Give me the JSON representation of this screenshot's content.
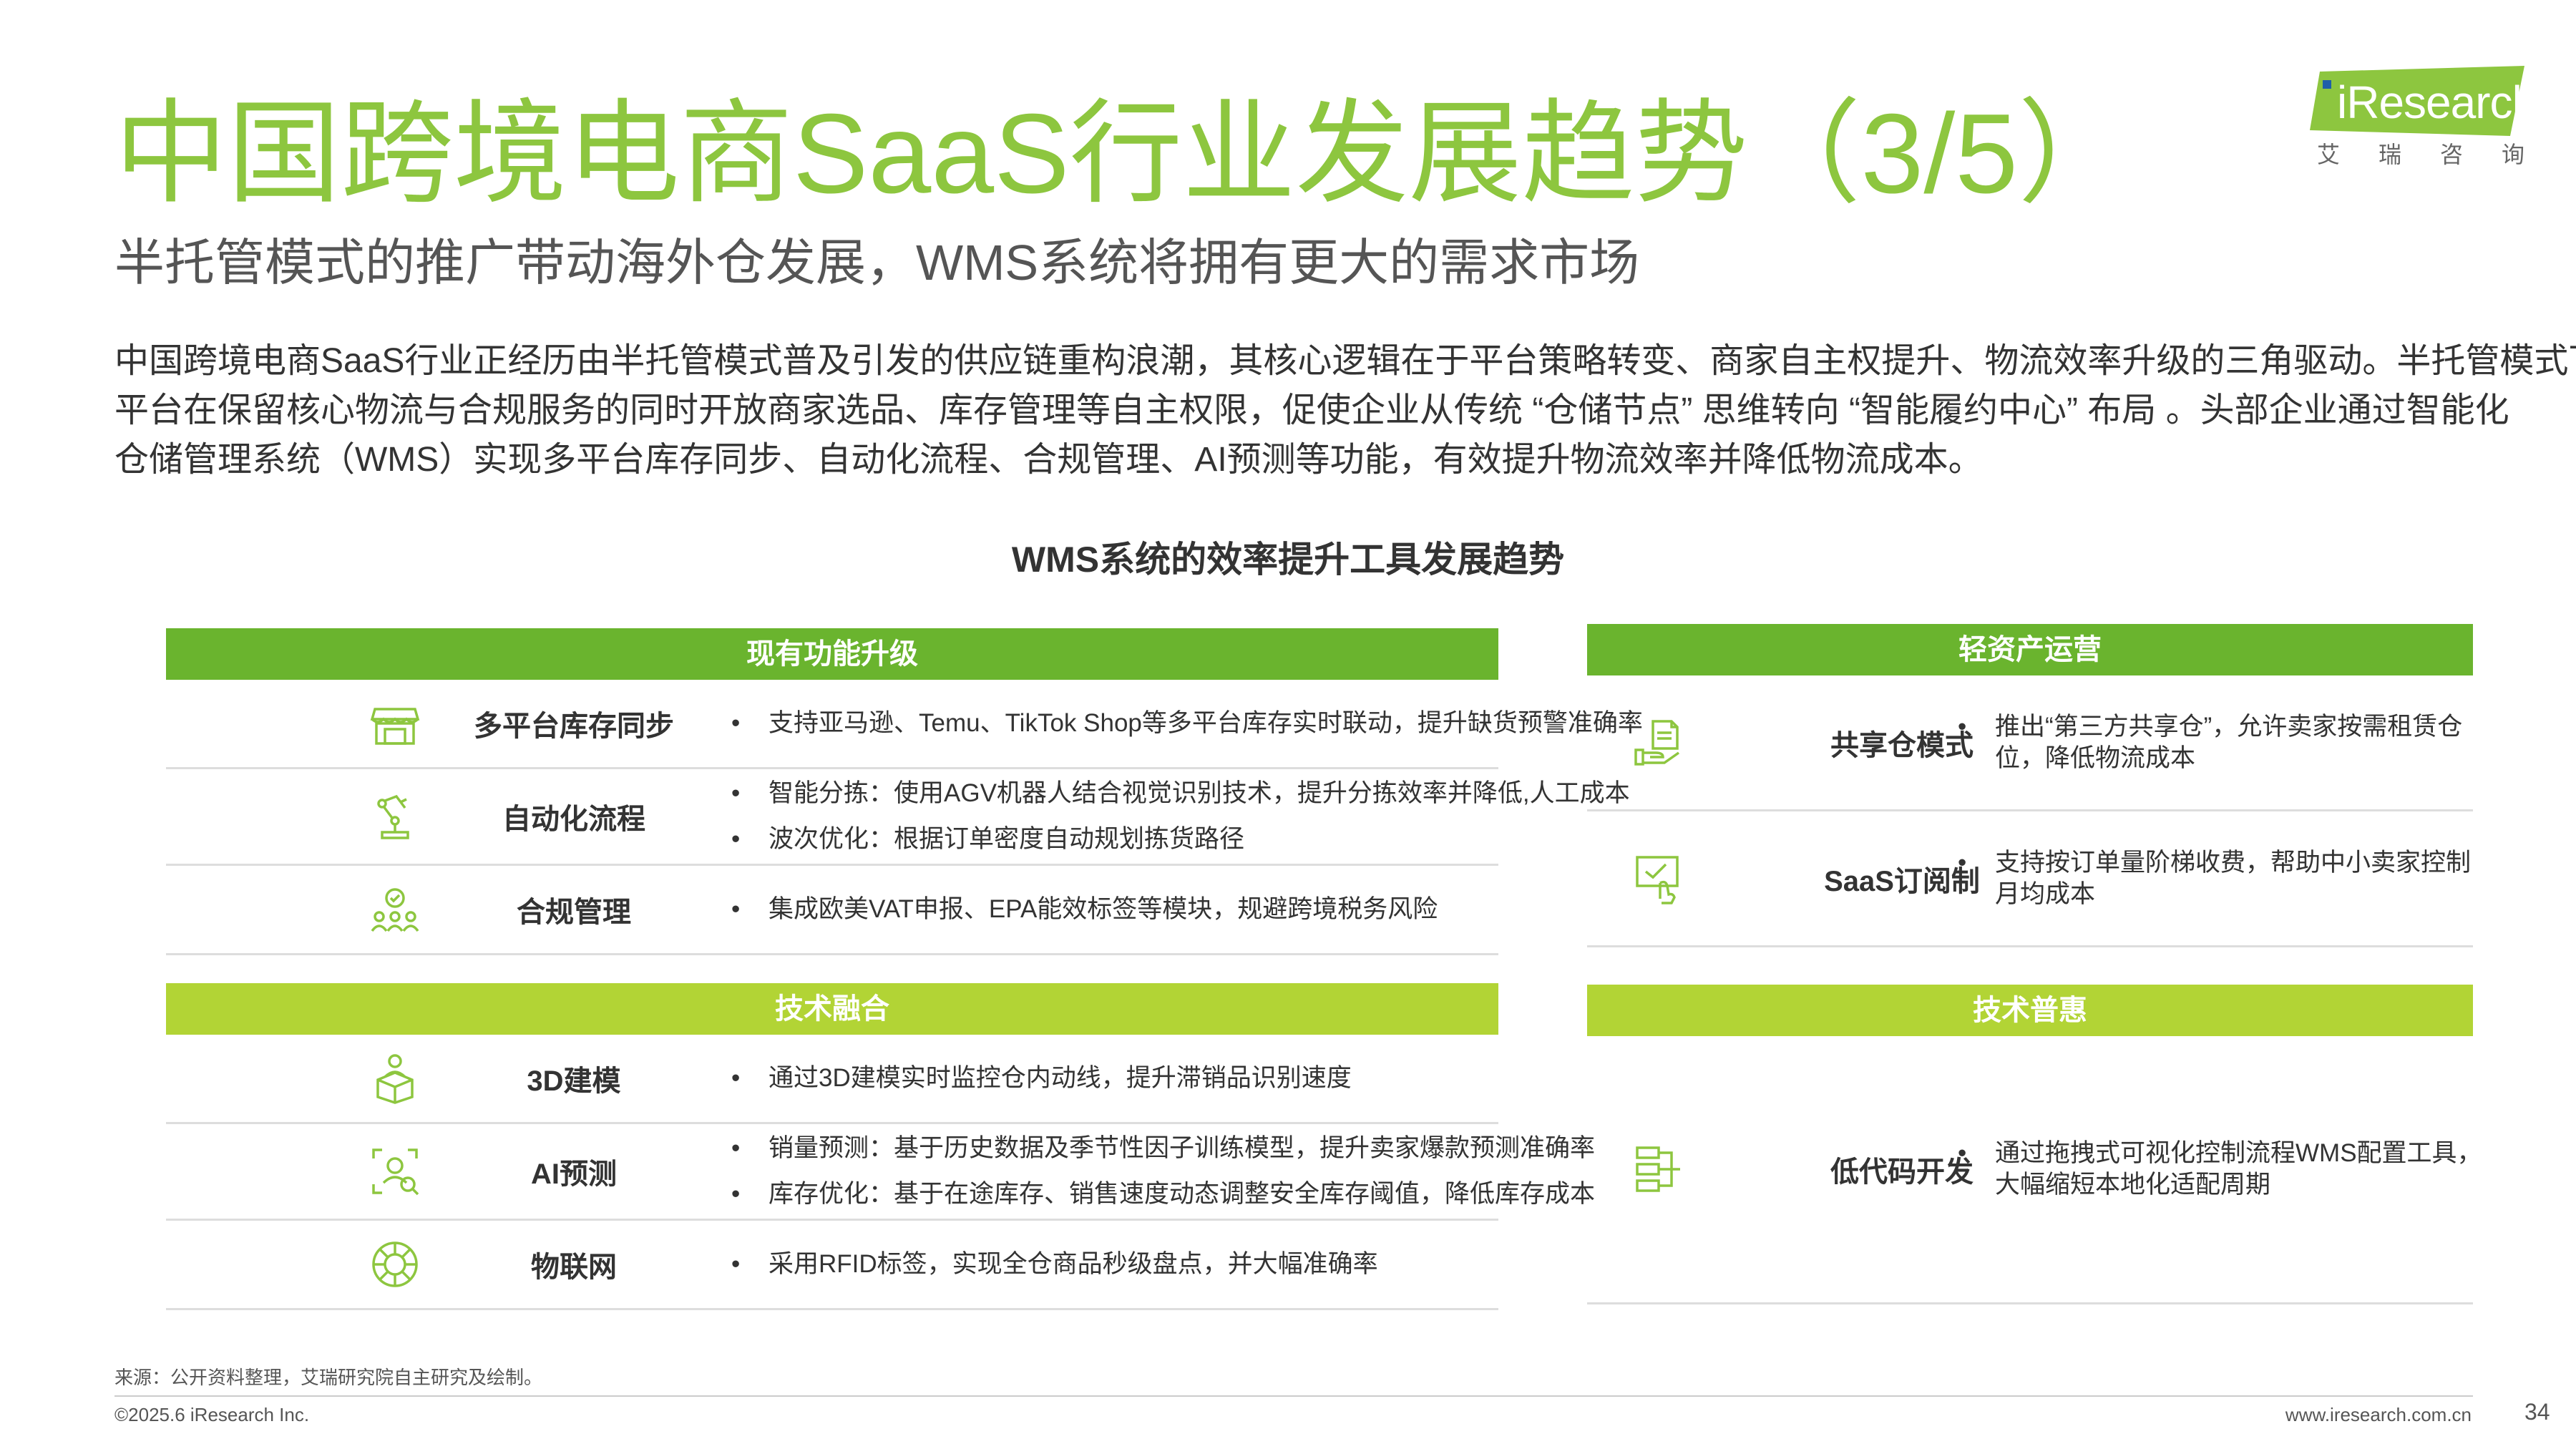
{
  "header": {
    "title": "中国跨境电商SaaS行业发展趋势（3/5）",
    "subtitle": "半托管模式的推广带动海外仓发展，WMS系统将拥有更大的需求市场"
  },
  "logo": {
    "text": "iResearch",
    "chars": [
      "艾",
      "瑞",
      "咨",
      "询"
    ],
    "color": "#8dc63f"
  },
  "intro": {
    "lines": [
      "中国跨境电商SaaS行业正经历由半托管模式普及引发的供应链重构浪潮，其核心逻辑在于平台策略转变、商家自主权提升、物流效率升级的三角驱动。半托管模式下，",
      "平台在保留核心物流与合规服务的同时开放商家选品、库存管理等自主权限，促使企业从传统 “仓储节点” 思维转向 “智能履约中心” 布局 。头部企业通过智能化",
      "仓储管理系统（WMS）实现多平台库存同步、自动化流程、合规管理、AI预测等功能，有效提升物流效率并降低物流成本。"
    ]
  },
  "diagram": {
    "title": "WMS系统的效率提升工具发展趋势",
    "colors": {
      "dark_green": "#6ab42e",
      "light_green": "#b2d435",
      "icon_green": "#8dc63f",
      "divider": "#dddddd"
    },
    "panels": {
      "existing": {
        "header": "现有功能升级",
        "rows": [
          {
            "icon": "storefront-icon",
            "name": "多平台库存同步",
            "bullets": [
              "支持亚马逊、Temu、TikTok Shop等多平台库存实时联动，提升缺货预警准确率"
            ]
          },
          {
            "icon": "robot-arm-icon",
            "name": "自动化流程",
            "bullets": [
              "智能分拣：使用AGV机器人结合视觉识别技术，提升分拣效率并降低,人工成本",
              "波次优化：根据订单密度自动规划拣货路径"
            ]
          },
          {
            "icon": "compliance-people-icon",
            "name": "合规管理",
            "bullets": [
              "集成欧美VAT申报、EPA能效标签等模块，规避跨境税务风险"
            ]
          }
        ]
      },
      "tech": {
        "header": "技术融合",
        "rows": [
          {
            "icon": "person-box-icon",
            "name": "3D建模",
            "bullets": [
              "通过3D建模实时监控仓内动线，提升滞销品识别速度"
            ]
          },
          {
            "icon": "face-scan-icon",
            "name": "AI预测",
            "bullets": [
              "销量预测：基于历史数据及季节性因子训练模型，提升卖家爆款预测准确率",
              "库存优化：基于在途库存、销售速度动态调整安全库存阈值，降低库存成本"
            ]
          },
          {
            "icon": "globe-network-icon",
            "name": "物联网",
            "bullets": [
              "采用RFID标签，实现全仓商品秒级盘点，并大幅准确率"
            ]
          }
        ]
      },
      "asset_light": {
        "header": "轻资产运营",
        "rows": [
          {
            "icon": "hand-document-icon",
            "name": "共享仓模式",
            "bullets": [
              "推出“第三方共享仓”，允许卖家按需租赁仓位，降低物流成本"
            ]
          },
          {
            "icon": "screen-touch-icon",
            "name": "SaaS订阅制",
            "bullets": [
              "支持按订单量阶梯收费，帮助中小卖家控制月均成本"
            ]
          }
        ]
      },
      "tech_inclusive": {
        "header": "技术普惠",
        "rows": [
          {
            "icon": "flowchart-icon",
            "name": "低代码开发",
            "bullets": [
              "通过拖拽式可视化控制流程WMS配置工具，大幅缩短本地化适配周期"
            ]
          }
        ]
      }
    }
  },
  "footer": {
    "source": "来源：公开资料整理，艾瑞研究院自主研究及绘制。",
    "copyright": "©2025.6 iResearch Inc.",
    "website": "www.iresearch.com.cn",
    "page": "34"
  }
}
